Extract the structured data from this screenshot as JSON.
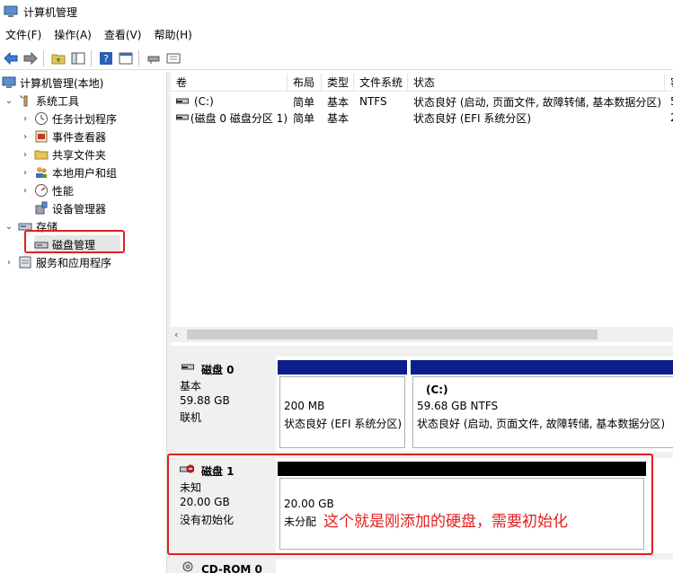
{
  "window": {
    "title": "计算机管理"
  },
  "menu": [
    "文件(F)",
    "操作(A)",
    "查看(V)",
    "帮助(H)"
  ],
  "tree": {
    "root": "计算机管理(本地)",
    "system_tools": "系统工具",
    "task_scheduler": "任务计划程序",
    "event_viewer": "事件查看器",
    "shared_folders": "共享文件夹",
    "local_users": "本地用户和组",
    "performance": "性能",
    "device_manager": "设备管理器",
    "storage": "存储",
    "disk_management": "磁盘管理",
    "services": "服务和应用程序"
  },
  "volume_list": {
    "columns": [
      "卷",
      "布局",
      "类型",
      "文件系统",
      "状态",
      "容"
    ],
    "rows": [
      [
        "(C:)",
        "简单",
        "基本",
        "NTFS",
        "状态良好 (启动, 页面文件, 故障转储, 基本数据分区)",
        "5"
      ],
      [
        "(磁盘 0 磁盘分区 1)",
        "简单",
        "基本",
        "",
        "状态良好 (EFI 系统分区)",
        "2"
      ]
    ]
  },
  "disks": [
    {
      "name": "磁盘 0",
      "type": "基本",
      "size": "59.88 GB",
      "status": "联机",
      "partitions": [
        {
          "title": "",
          "size": "200 MB",
          "status": "状态良好 (EFI 系统分区)"
        },
        {
          "title": "(C:)",
          "size": "59.68 GB NTFS",
          "status": "状态良好 (启动, 页面文件, 故障转储, 基本数据分区)"
        }
      ]
    },
    {
      "name": "磁盘 1",
      "type": "未知",
      "size": "20.00 GB",
      "status": "没有初始化",
      "partitions": [
        {
          "size": "20.00 GB",
          "status": "未分配"
        }
      ]
    },
    {
      "name": "CD-ROM 0"
    }
  ],
  "annotation": "这个就是刚添加的硬盘，需要初始化",
  "colors": {
    "primary_partition": "#0a1e8c",
    "unallocated": "#000000",
    "highlight": "#e0201e"
  }
}
